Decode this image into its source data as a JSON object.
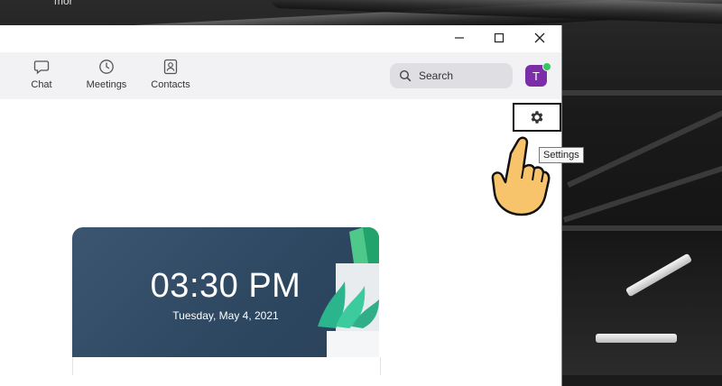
{
  "background": {
    "corner_text": "mor"
  },
  "window": {
    "controls": {
      "minimize": "minimize",
      "maximize": "maximize",
      "close": "close"
    }
  },
  "toolbar": {
    "nav": [
      {
        "label": "Chat",
        "icon": "chat-icon"
      },
      {
        "label": "Meetings",
        "icon": "clock-icon"
      },
      {
        "label": "Contacts",
        "icon": "contacts-icon"
      }
    ],
    "search": {
      "label": "Search",
      "icon": "search-icon"
    },
    "avatar": {
      "initial": "T",
      "color": "#7b2ea8",
      "status_color": "#34c759"
    }
  },
  "settings": {
    "icon": "gear-icon",
    "tooltip": "Settings"
  },
  "card": {
    "time": "03:30 PM",
    "date": "Tuesday, May 4, 2021"
  }
}
